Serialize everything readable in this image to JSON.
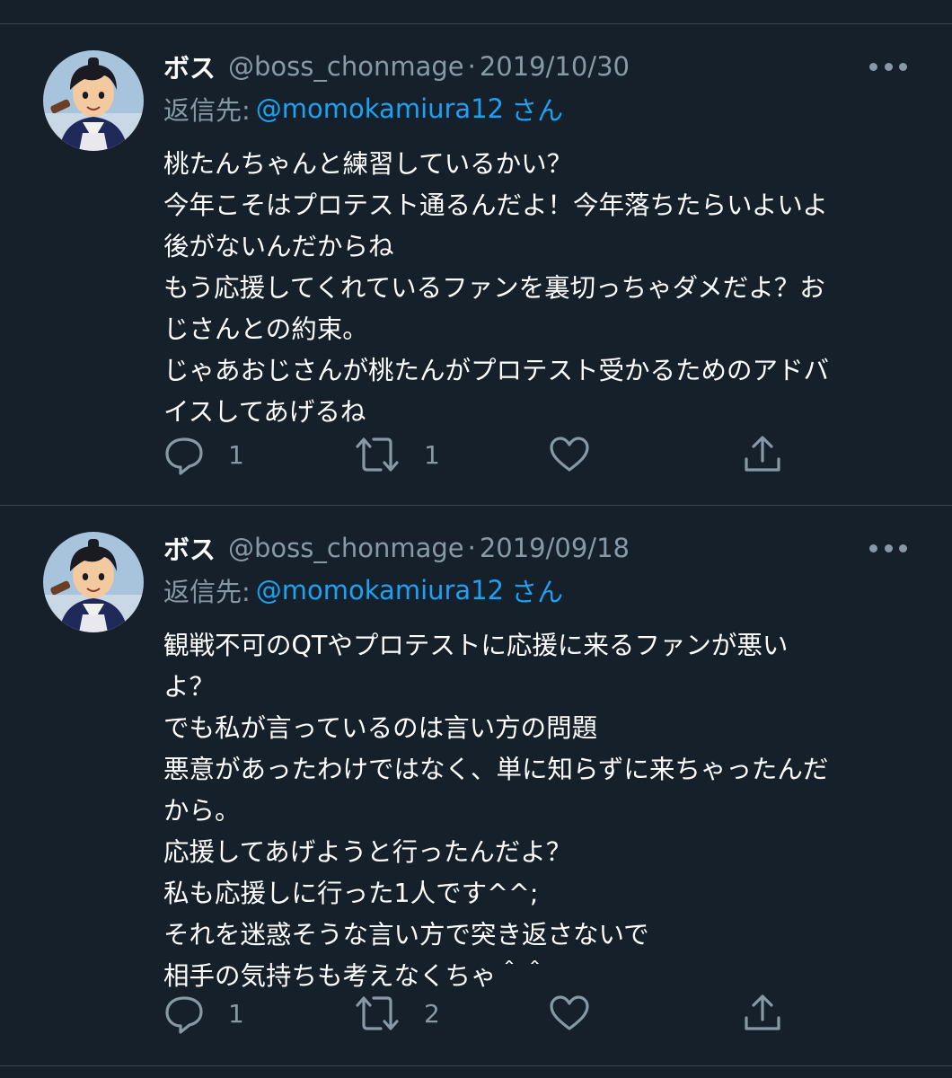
{
  "tweets": [
    {
      "name": "ボス",
      "handle": "@boss_chonmage",
      "dot": "·",
      "date": "2019/10/30",
      "reply_prefix": "返信先:",
      "reply_to": "@momokamiura12",
      "reply_suffix": "さん",
      "lines": [
        "桃たんちゃんと練習しているかい？",
        "今年こそはプロテスト通るんだよ！今年落ちたらいよいよ",
        "後がないんだからね",
        "もう応援してくれているファンを裏切っちゃダメだよ？お",
        "じさんとの約束。",
        "じゃあおじさんが桃たんがプロテスト受かるためのアドバ",
        "イスしてあげるね"
      ],
      "reply_count": "1",
      "retweet_count": "1"
    },
    {
      "name": "ボス",
      "handle": "@boss_chonmage",
      "dot": "·",
      "date": "2019/09/18",
      "reply_prefix": "返信先:",
      "reply_to": "@momokamiura12",
      "reply_suffix": "さん",
      "lines": [
        "観戦不可のQTやプロテストに応援に来るファンが悪い",
        "よ？",
        "でも私が言っているのは言い方の問題",
        "悪意があったわけではなく、単に知らずに来ちゃったんだ",
        "から。",
        "応援してあげようと行ったんだよ？",
        "私も応援しに行った1人です^^;",
        "それを迷惑そうな言い方で突き返さないで",
        "相手の気持ちも考えなくちゃ＾＾"
      ],
      "reply_count": "1",
      "retweet_count": "2"
    }
  ],
  "icons": {
    "more": "more-horizontal-icon",
    "reply": "reply-bubble-icon",
    "retweet": "retweet-icon",
    "like": "heart-icon",
    "share": "share-icon"
  },
  "colors": {
    "background": "#15202b",
    "divider": "#38444d",
    "secondary_text": "#8899a6",
    "link": "#1da1f2"
  }
}
